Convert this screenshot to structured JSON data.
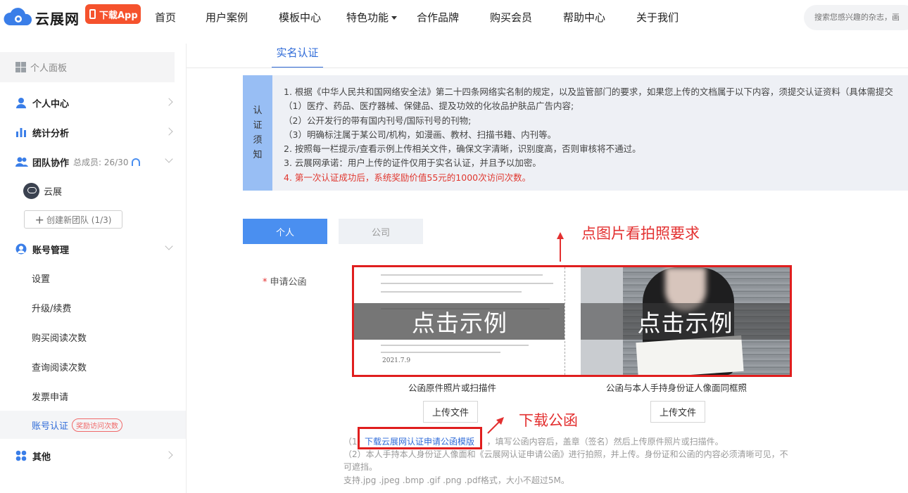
{
  "header": {
    "brand": "云展网",
    "app_button": "下载App",
    "nav": [
      {
        "label": "首页"
      },
      {
        "label": "用户案例"
      },
      {
        "label": "模板中心"
      },
      {
        "label": "特色功能"
      },
      {
        "label": "合作品牌"
      },
      {
        "label": "购买会员"
      },
      {
        "label": "帮助中心"
      },
      {
        "label": "关于我们"
      }
    ],
    "search_placeholder": "搜索您感兴趣的杂志，画"
  },
  "sidebar": {
    "panel_title": "个人面板",
    "sections": [
      {
        "label": "个人中心"
      },
      {
        "label": "统计分析"
      },
      {
        "label": "团队协作",
        "count": "总成员: 26/30"
      },
      {
        "label": "账号管理"
      },
      {
        "label": "其他"
      }
    ],
    "team_name": "云展",
    "new_team": "创建新团队 (1/3)",
    "account_items": [
      {
        "label": "设置"
      },
      {
        "label": "升级/续费"
      },
      {
        "label": "购买阅读次数"
      },
      {
        "label": "查询阅读次数"
      },
      {
        "label": "发票申请"
      },
      {
        "label": "账号认证",
        "badge": "奖励访问次数"
      }
    ]
  },
  "main": {
    "tab": "实名认证",
    "notice_side": [
      "认",
      "证",
      "须",
      "知"
    ],
    "notice_lines": [
      "1. 根据《中华人民共和国网络安全法》第二十四条网络实名制的规定，以及监管部门的要求，如果您上传的文档属于以下内容，须提交认证资料（具体需提交",
      "（1）医疗、药品、医疗器械、保健品、提及功效的化妆品护肤品广告内容;",
      "（2）公开发行的带有国内刊号/国际刊号的刊物;",
      "（3）明确标注属于某公司/机构，如漫画、教材、扫描书籍、内刊等。",
      "2. 按照每一栏提示/查看示例上传相关文件，确保文字清晰，识别度高，否则审核将不通过。",
      "3. 云展网承诺：用户上传的证件仅用于实名认证，并且予以加密。"
    ],
    "notice_red": "4. 第一次认证成功后，系统奖励价值55元的1000次访问次数。",
    "type_tabs": [
      "个人",
      "公司"
    ],
    "annotation_photo": "点图片看拍照要求",
    "annotation_download": "下载公函",
    "field_label": "申请公函",
    "example_text": "点击示例",
    "doc_signature": "2021.7.9",
    "captions": [
      "公函原件照片或扫描件",
      "公函与本人手持身份证人像面同框照"
    ],
    "upload_label": "上传文件",
    "download_link": "下载云展网认证申请公函模版",
    "hint_1_prefix": "（1）",
    "hint_1_rest": "，填写公函内容后，盖章（签名）然后上传原件照片或扫描件。",
    "hint_2_a": "（2）本人手持本人身份证人像面和《云展网认证申请公函》进行拍照，并上传。身份证和公函的内容必须清晰可见，不",
    "hint_2_b": "可遮挡。",
    "hint_3": "支持.jpg .jpeg .bmp .gif .png .pdf格式，大小不超过5M。"
  },
  "colors": {
    "accent": "#2f6bd8",
    "tab_active": "#4a8ff0",
    "notice_side": "#98bef4",
    "brand_orange": "#f5522d",
    "annotation_red": "#e33030"
  }
}
